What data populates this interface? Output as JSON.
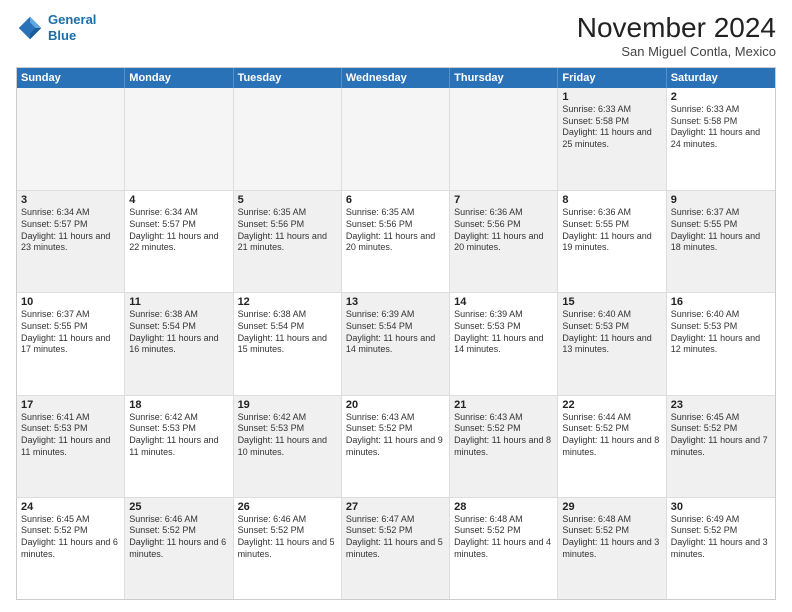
{
  "logo": {
    "line1": "General",
    "line2": "Blue"
  },
  "title": "November 2024",
  "location": "San Miguel Contla, Mexico",
  "headers": [
    "Sunday",
    "Monday",
    "Tuesday",
    "Wednesday",
    "Thursday",
    "Friday",
    "Saturday"
  ],
  "weeks": [
    [
      {
        "day": "",
        "text": "",
        "empty": true
      },
      {
        "day": "",
        "text": "",
        "empty": true
      },
      {
        "day": "",
        "text": "",
        "empty": true
      },
      {
        "day": "",
        "text": "",
        "empty": true
      },
      {
        "day": "",
        "text": "",
        "empty": true
      },
      {
        "day": "1",
        "text": "Sunrise: 6:33 AM\nSunset: 5:58 PM\nDaylight: 11 hours and 25 minutes.",
        "shaded": true
      },
      {
        "day": "2",
        "text": "Sunrise: 6:33 AM\nSunset: 5:58 PM\nDaylight: 11 hours and 24 minutes.",
        "shaded": false
      }
    ],
    [
      {
        "day": "3",
        "text": "Sunrise: 6:34 AM\nSunset: 5:57 PM\nDaylight: 11 hours and 23 minutes.",
        "shaded": true
      },
      {
        "day": "4",
        "text": "Sunrise: 6:34 AM\nSunset: 5:57 PM\nDaylight: 11 hours and 22 minutes.",
        "shaded": false
      },
      {
        "day": "5",
        "text": "Sunrise: 6:35 AM\nSunset: 5:56 PM\nDaylight: 11 hours and 21 minutes.",
        "shaded": true
      },
      {
        "day": "6",
        "text": "Sunrise: 6:35 AM\nSunset: 5:56 PM\nDaylight: 11 hours and 20 minutes.",
        "shaded": false
      },
      {
        "day": "7",
        "text": "Sunrise: 6:36 AM\nSunset: 5:56 PM\nDaylight: 11 hours and 20 minutes.",
        "shaded": true
      },
      {
        "day": "8",
        "text": "Sunrise: 6:36 AM\nSunset: 5:55 PM\nDaylight: 11 hours and 19 minutes.",
        "shaded": false
      },
      {
        "day": "9",
        "text": "Sunrise: 6:37 AM\nSunset: 5:55 PM\nDaylight: 11 hours and 18 minutes.",
        "shaded": true
      }
    ],
    [
      {
        "day": "10",
        "text": "Sunrise: 6:37 AM\nSunset: 5:55 PM\nDaylight: 11 hours and 17 minutes.",
        "shaded": false
      },
      {
        "day": "11",
        "text": "Sunrise: 6:38 AM\nSunset: 5:54 PM\nDaylight: 11 hours and 16 minutes.",
        "shaded": true
      },
      {
        "day": "12",
        "text": "Sunrise: 6:38 AM\nSunset: 5:54 PM\nDaylight: 11 hours and 15 minutes.",
        "shaded": false
      },
      {
        "day": "13",
        "text": "Sunrise: 6:39 AM\nSunset: 5:54 PM\nDaylight: 11 hours and 14 minutes.",
        "shaded": true
      },
      {
        "day": "14",
        "text": "Sunrise: 6:39 AM\nSunset: 5:53 PM\nDaylight: 11 hours and 14 minutes.",
        "shaded": false
      },
      {
        "day": "15",
        "text": "Sunrise: 6:40 AM\nSunset: 5:53 PM\nDaylight: 11 hours and 13 minutes.",
        "shaded": true
      },
      {
        "day": "16",
        "text": "Sunrise: 6:40 AM\nSunset: 5:53 PM\nDaylight: 11 hours and 12 minutes.",
        "shaded": false
      }
    ],
    [
      {
        "day": "17",
        "text": "Sunrise: 6:41 AM\nSunset: 5:53 PM\nDaylight: 11 hours and 11 minutes.",
        "shaded": true
      },
      {
        "day": "18",
        "text": "Sunrise: 6:42 AM\nSunset: 5:53 PM\nDaylight: 11 hours and 11 minutes.",
        "shaded": false
      },
      {
        "day": "19",
        "text": "Sunrise: 6:42 AM\nSunset: 5:53 PM\nDaylight: 11 hours and 10 minutes.",
        "shaded": true
      },
      {
        "day": "20",
        "text": "Sunrise: 6:43 AM\nSunset: 5:52 PM\nDaylight: 11 hours and 9 minutes.",
        "shaded": false
      },
      {
        "day": "21",
        "text": "Sunrise: 6:43 AM\nSunset: 5:52 PM\nDaylight: 11 hours and 8 minutes.",
        "shaded": true
      },
      {
        "day": "22",
        "text": "Sunrise: 6:44 AM\nSunset: 5:52 PM\nDaylight: 11 hours and 8 minutes.",
        "shaded": false
      },
      {
        "day": "23",
        "text": "Sunrise: 6:45 AM\nSunset: 5:52 PM\nDaylight: 11 hours and 7 minutes.",
        "shaded": true
      }
    ],
    [
      {
        "day": "24",
        "text": "Sunrise: 6:45 AM\nSunset: 5:52 PM\nDaylight: 11 hours and 6 minutes.",
        "shaded": false
      },
      {
        "day": "25",
        "text": "Sunrise: 6:46 AM\nSunset: 5:52 PM\nDaylight: 11 hours and 6 minutes.",
        "shaded": true
      },
      {
        "day": "26",
        "text": "Sunrise: 6:46 AM\nSunset: 5:52 PM\nDaylight: 11 hours and 5 minutes.",
        "shaded": false
      },
      {
        "day": "27",
        "text": "Sunrise: 6:47 AM\nSunset: 5:52 PM\nDaylight: 11 hours and 5 minutes.",
        "shaded": true
      },
      {
        "day": "28",
        "text": "Sunrise: 6:48 AM\nSunset: 5:52 PM\nDaylight: 11 hours and 4 minutes.",
        "shaded": false
      },
      {
        "day": "29",
        "text": "Sunrise: 6:48 AM\nSunset: 5:52 PM\nDaylight: 11 hours and 3 minutes.",
        "shaded": true
      },
      {
        "day": "30",
        "text": "Sunrise: 6:49 AM\nSunset: 5:52 PM\nDaylight: 11 hours and 3 minutes.",
        "shaded": false
      }
    ]
  ]
}
